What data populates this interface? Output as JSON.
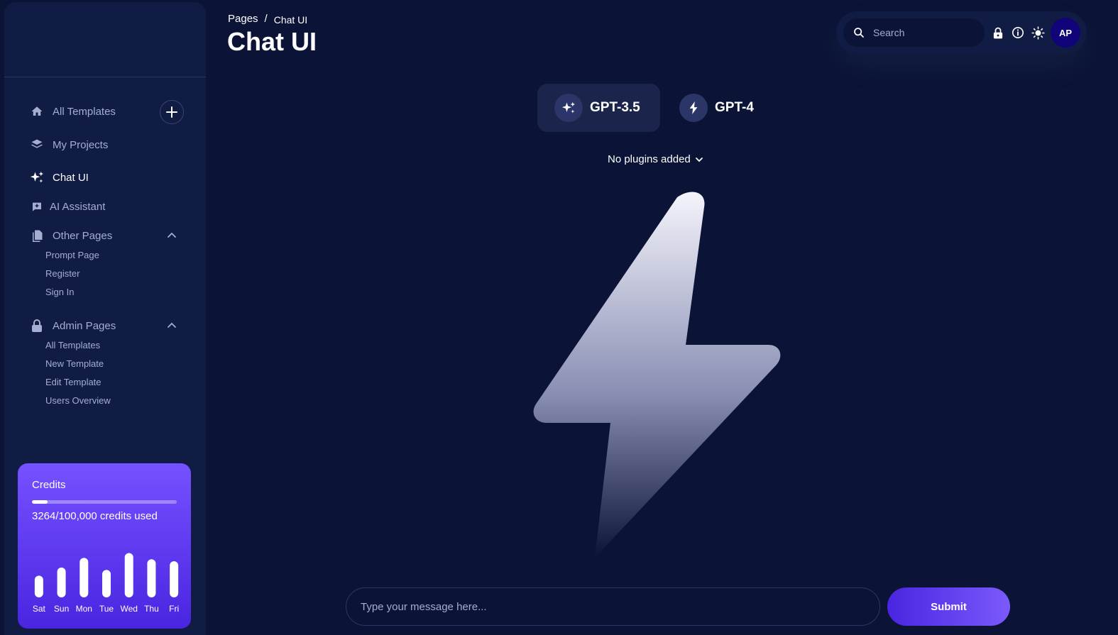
{
  "breadcrumb": {
    "root": "Pages",
    "separator": "/",
    "current": "Chat UI"
  },
  "page_title": "Chat UI",
  "search": {
    "placeholder": "Search"
  },
  "user": {
    "initials": "AP"
  },
  "sidebar": {
    "items": [
      {
        "label": "All Templates",
        "icon": "home-icon"
      },
      {
        "label": "My Projects",
        "icon": "layers-icon"
      },
      {
        "label": "Chat UI",
        "icon": "sparkles-icon",
        "active": true
      },
      {
        "label": "AI Assistant",
        "icon": "assistant-icon"
      },
      {
        "label": "Other Pages",
        "icon": "documents-icon",
        "expanded": true
      },
      {
        "label": "Admin Pages",
        "icon": "lock-icon",
        "expanded": true
      }
    ],
    "other_pages": [
      "Prompt Page",
      "Register",
      "Sign In"
    ],
    "admin_pages": [
      "All Templates",
      "New Template",
      "Edit Template",
      "Users Overview"
    ]
  },
  "credits": {
    "title": "Credits",
    "used_text": "3264/100,000 credits used",
    "used_fraction": 0.11,
    "chart_data": {
      "type": "bar",
      "categories": [
        "Sat",
        "Sun",
        "Mon",
        "Tue",
        "Wed",
        "Thu",
        "Fri"
      ],
      "values": [
        45,
        62,
        82,
        57,
        92,
        79,
        75
      ],
      "ylim": [
        0,
        100
      ]
    }
  },
  "models": [
    {
      "label": "GPT-3.5",
      "icon": "sparkles-icon",
      "selected": true
    },
    {
      "label": "GPT-4",
      "icon": "bolt-icon",
      "selected": false
    }
  ],
  "plugins": {
    "label": "No plugins added"
  },
  "message": {
    "placeholder": "Type your message here..."
  },
  "submit_label": "Submit",
  "colors": {
    "background": "#0b1437",
    "sidebar": "#111c44",
    "accent_start": "#4a25e1",
    "accent_end": "#7b5afb",
    "muted_text": "#a3aed0"
  }
}
